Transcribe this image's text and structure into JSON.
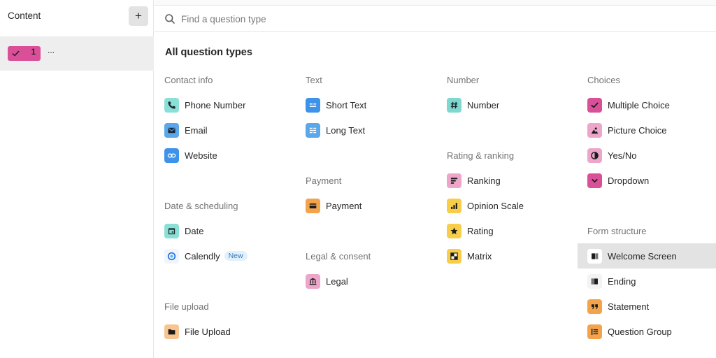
{
  "sidebar": {
    "title": "Content",
    "add_label": "+",
    "question": {
      "number": "1",
      "more": "..."
    }
  },
  "search": {
    "placeholder": "Find a question type",
    "value": ""
  },
  "main": {
    "title": "All question types",
    "sections": {
      "contact": {
        "label": "Contact info",
        "items": [
          "Phone Number",
          "Email",
          "Website"
        ]
      },
      "date": {
        "label": "Date & scheduling",
        "items": [
          "Date",
          "Calendly"
        ],
        "new_badge": "New"
      },
      "file": {
        "label": "File upload",
        "items": [
          "File Upload"
        ]
      },
      "text": {
        "label": "Text",
        "items": [
          "Short Text",
          "Long Text"
        ]
      },
      "payment": {
        "label": "Payment",
        "items": [
          "Payment"
        ]
      },
      "legal": {
        "label": "Legal & consent",
        "items": [
          "Legal"
        ]
      },
      "number": {
        "label": "Number",
        "items": [
          "Number"
        ]
      },
      "rating": {
        "label": "Rating & ranking",
        "items": [
          "Ranking",
          "Opinion Scale",
          "Rating",
          "Matrix"
        ]
      },
      "choices": {
        "label": "Choices",
        "items": [
          "Multiple Choice",
          "Picture Choice",
          "Yes/No",
          "Dropdown"
        ]
      },
      "structure": {
        "label": "Form structure",
        "items": [
          "Welcome Screen",
          "Ending",
          "Statement",
          "Question Group"
        ]
      }
    }
  },
  "colors": {
    "teal": "#7fd8cf",
    "blue": "#3d92ea",
    "lightblue": "#5aa7ea",
    "pink": "#d94f98",
    "lightpink": "#eda6c9",
    "yellow": "#f7cd4a",
    "orange": "#f2a34b",
    "lightorange": "#f6c590",
    "highlight": "#e3e3e3"
  }
}
